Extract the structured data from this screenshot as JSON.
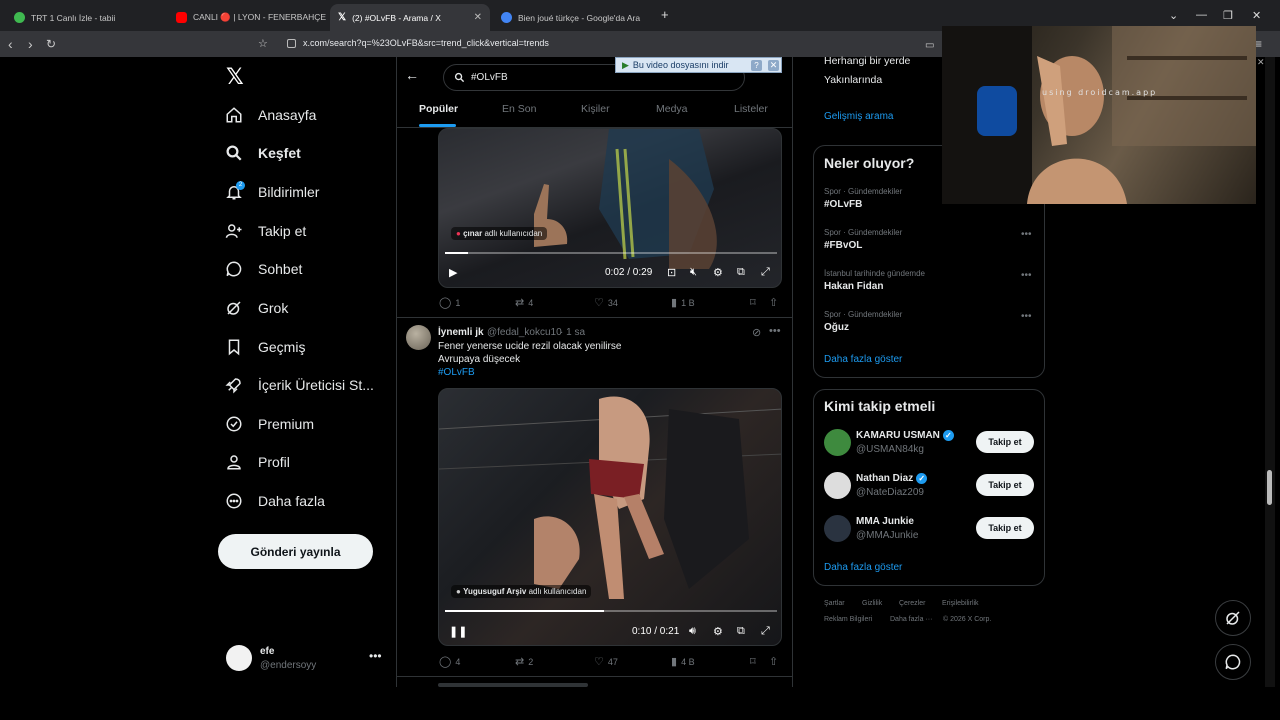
{
  "browser": {
    "tabs": [
      {
        "title": "TRT 1 Canlı İzle - tabii",
        "favicon_color": "#3fb950"
      },
      {
        "title": "CANLI 🔴 | LYON - FENERBAHÇE Ma:",
        "favicon_color": "#ff0000"
      },
      {
        "title": "(2) #OLvFB - Arama / X",
        "favicon_color": "#ffffff"
      },
      {
        "title": "Bien joué türkçe - Google'da Ara",
        "favicon_color": "#4285f4"
      }
    ],
    "url": "x.com/search?q=%23OLvFB&src=trend_click&vertical=trends"
  },
  "nav": {
    "items": [
      {
        "label": "Anasayfa",
        "icon": "home-icon"
      },
      {
        "label": "Keşfet",
        "icon": "search-icon"
      },
      {
        "label": "Bildirimler",
        "icon": "bell-icon"
      },
      {
        "label": "Takip et",
        "icon": "follow-icon"
      },
      {
        "label": "Sohbet",
        "icon": "chat-icon"
      },
      {
        "label": "Grok",
        "icon": "grok-icon"
      },
      {
        "label": "Geçmiş",
        "icon": "bookmark-icon"
      },
      {
        "label": "İçerik Üreticisi St...",
        "icon": "rocket-icon"
      },
      {
        "label": "Premium",
        "icon": "verified-icon"
      },
      {
        "label": "Profil",
        "icon": "person-icon"
      },
      {
        "label": "Daha fazla",
        "icon": "more-circle-icon"
      }
    ],
    "notif_badge": "2",
    "post_button": "Gönderi yayınla",
    "user": {
      "name": "efe",
      "handle": "@endersoyy"
    }
  },
  "search": {
    "query": "#OLvFB",
    "tabs": [
      "Popüler",
      "En Son",
      "Kişiler",
      "Medya",
      "Listeler"
    ]
  },
  "tweet1": {
    "video": {
      "credit_name": "çınar",
      "credit_suffix": "adlı kullanıcıdan",
      "time": "0:02 / 0:29",
      "progress": 0.07
    },
    "actions": {
      "replies": "1",
      "reposts": "4",
      "likes": "34",
      "views": "1 B"
    }
  },
  "tweet2": {
    "name": "İynemli jk",
    "handle": "@fedal_kokcu10",
    "time": "· 1 sa",
    "lines": [
      "Fener yenerse ucide rezil olacak yenilirse",
      "Avrupaya düşecek"
    ],
    "hashtag": "#OLvFB",
    "video": {
      "credit_name": "Yugusuguf Arşiv",
      "credit_suffix": "adlı kullanıcıdan",
      "time": "0:10 / 0:21",
      "progress": 0.48
    },
    "actions": {
      "replies": "4",
      "reposts": "2",
      "likes": "47",
      "views": "4 B"
    }
  },
  "right": {
    "location_options": [
      "Herhangi bir yerde",
      "Yakınlarında"
    ],
    "advanced_search": "Gelişmiş arama",
    "trends_title": "Neler oluyor?",
    "trends": [
      {
        "meta": "Spor · Gündemdekiler",
        "name": "#OLvFB"
      },
      {
        "meta": "Spor · Gündemdekiler",
        "name": "#FBvOL"
      },
      {
        "meta": "İstanbul tarihinde gündemde",
        "name": "Hakan Fidan"
      },
      {
        "meta": "Spor · Gündemdekiler",
        "name": "Oğuz"
      }
    ],
    "show_more": "Daha fazla göster",
    "follow_title": "Kimi takip etmeli",
    "follow_suggestions": [
      {
        "name": "KAMARU USMAN",
        "handle": "@USMAN84kg",
        "verified": true,
        "avatar_color": "#3e8a3e"
      },
      {
        "name": "Nathan Diaz",
        "handle": "@NateDiaz209",
        "verified": true,
        "avatar_color": "#dddddd"
      },
      {
        "name": "MMA Junkie",
        "handle": "@MMAJunkie",
        "verified": false,
        "avatar_color": "#2a3340"
      }
    ],
    "follow_button": "Takip et",
    "footer": [
      "Şartlar",
      "Gizlilik",
      "Çerezler",
      "Erişilebilirlik",
      "Reklam Bilgileri",
      "Daha fazla ···",
      "© 2026 X Corp."
    ]
  },
  "overlays": {
    "download_bar": "Bu video dosyasını indir",
    "cam_label": "using droidcam.app"
  },
  "colors": {
    "accent": "#1d9bf0",
    "background": "#000000",
    "border": "#2f3336",
    "muted": "#71767b"
  }
}
